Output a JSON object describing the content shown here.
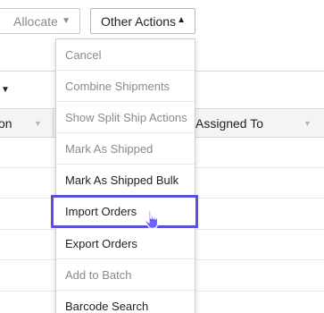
{
  "toolbar": {
    "allocate_label": "Allocate",
    "other_actions_label": "Other Actions"
  },
  "table": {
    "columns": [
      {
        "label": "on"
      },
      {
        "label": "Assigned To"
      }
    ]
  },
  "menu": {
    "items": [
      {
        "label": "Cancel",
        "enabled": false
      },
      {
        "label": "Combine Shipments",
        "enabled": false
      },
      {
        "label": "Show Split Ship Actions",
        "enabled": false
      },
      {
        "label": "Mark As Shipped",
        "enabled": false
      },
      {
        "label": "Mark As Shipped Bulk",
        "enabled": true
      },
      {
        "label": "Import Orders",
        "enabled": true,
        "highlighted": true
      },
      {
        "label": "Export Orders",
        "enabled": true
      },
      {
        "label": "Add to Batch",
        "enabled": false
      },
      {
        "label": "Barcode Search",
        "enabled": true
      }
    ]
  },
  "colors": {
    "highlight_border": "#5b4fe0",
    "disabled_text": "#8a8a8a",
    "enabled_text": "#222222",
    "cursor_fill": "#6c63ff"
  },
  "icons": {
    "dropdown_caret": "caret-down-icon",
    "open_caret": "caret-up-icon",
    "pointer": "hand-pointer-icon"
  }
}
